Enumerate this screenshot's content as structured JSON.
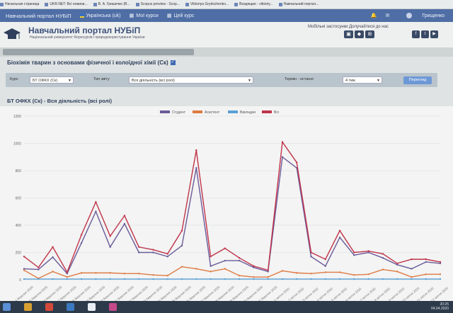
{
  "bookmarks": [
    {
      "label": "Начальная страница"
    },
    {
      "label": "UKR.NET: Всі новини..."
    },
    {
      "label": "В. А. Гришечко (В..."
    },
    {
      "label": "Scopus preview - Scop..."
    },
    {
      "label": "Viktoriya Grydschenko..."
    },
    {
      "label": "Входящие - viktoriy..."
    },
    {
      "label": "Навчальний портал..."
    }
  ],
  "topnav": {
    "brand": "Навчальний портал НУБіП",
    "lang": "Українська (uk)",
    "my_courses": "Мої курси",
    "this_course": "Цей курс",
    "user": "Грищенко"
  },
  "header": {
    "title": "Навчальний портал НУБіП",
    "subtitle": "Національний університет біоресурсів і природокористування України",
    "mobile": "Мобільні застосунки  Долучайтеся до нас"
  },
  "course": {
    "title": "Біохімія тварин з основами фізичної і колоїдної хімії (Ск)"
  },
  "filters": {
    "course_label": "Курс",
    "course_value": "БТ ОФКХ (Ск)",
    "type_label": "Тип звіту",
    "type_value": "Вся діяльність (всі ролі)",
    "period_label": "Термін - останні",
    "period_value": "4 тиж",
    "button": "Перегляд"
  },
  "chart_title": "БТ ОФКХ (Ск) - Вся діяльність (всі ролі)",
  "chart_data": {
    "type": "line",
    "ylim": [
      0,
      1200
    ],
    "yticks": [
      0,
      200,
      400,
      600,
      800,
      1000,
      1200
    ],
    "x": [
      "14 березня 2020",
      "15 березня 2020",
      "16 березня 2020",
      "17 березня 2020",
      "18 березня 2020",
      "19 березня 2020",
      "20 березня 2020",
      "21 березня 2020",
      "22 березня 2020",
      "23 березня 2020",
      "24 березня 2020",
      "25 березня 2020",
      "26 березня 2020",
      "27 березня 2020",
      "28 березня 2020",
      "29 березня 2020",
      "30 березня 2020",
      "31 березня 2020",
      "1 квітня 2020",
      "2 квітня 2020",
      "3 квітня 2020",
      "4 квітня 2020",
      "5 квітня 2020",
      "6 квітня 2020",
      "7 квітня 2020",
      "8 квітня 2020",
      "9 квітня 2020",
      "10 квітня 2020",
      "11 квітня 2020",
      "12 квітня 2020"
    ],
    "series": [
      {
        "name": "Студент",
        "color": "#6b5a9a",
        "values": [
          80,
          75,
          165,
          45,
          270,
          500,
          240,
          410,
          200,
          200,
          170,
          250,
          820,
          100,
          140,
          140,
          90,
          60,
          900,
          820,
          170,
          100,
          310,
          180,
          200,
          160,
          110,
          80,
          130,
          120
        ]
      },
      {
        "name": "Асистент",
        "color": "#e07a43",
        "values": [
          70,
          10,
          60,
          20,
          50,
          50,
          50,
          45,
          45,
          35,
          30,
          95,
          80,
          60,
          80,
          30,
          20,
          20,
          65,
          50,
          45,
          55,
          55,
          35,
          40,
          75,
          60,
          20,
          40,
          40
        ]
      },
      {
        "name": "Викладач",
        "color": "#5aa0d6",
        "values": [
          5,
          5,
          5,
          5,
          5,
          5,
          5,
          5,
          5,
          5,
          5,
          5,
          5,
          5,
          5,
          5,
          5,
          5,
          5,
          5,
          5,
          5,
          5,
          5,
          5,
          5,
          5,
          5,
          5,
          5
        ]
      },
      {
        "name": "Всі",
        "color": "#c0334a",
        "values": [
          170,
          90,
          240,
          55,
          330,
          570,
          320,
          470,
          240,
          220,
          190,
          360,
          950,
          170,
          230,
          160,
          100,
          70,
          1010,
          860,
          200,
          150,
          360,
          200,
          210,
          190,
          120,
          150,
          150,
          130
        ]
      }
    ]
  },
  "taskbar": {
    "time": "20:25",
    "date": "04.04.2020"
  }
}
